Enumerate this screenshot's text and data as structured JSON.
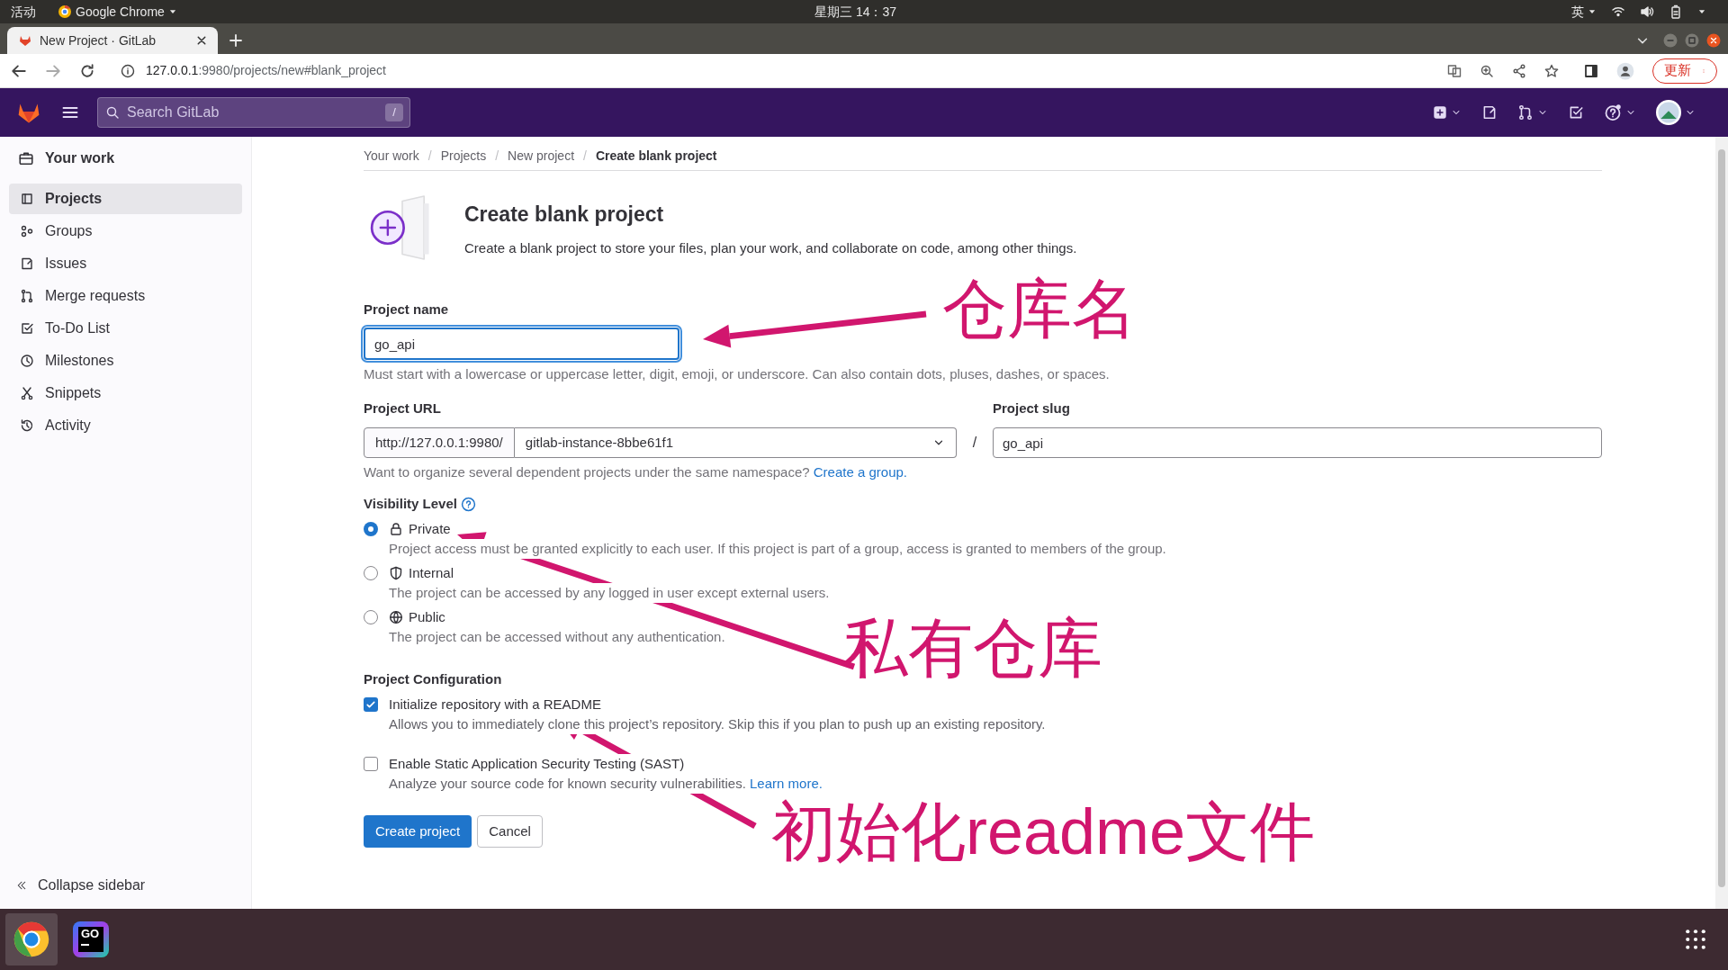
{
  "system_bar": {
    "activities": "活动",
    "app": "Google Chrome",
    "clock": "星期三 14：37",
    "input_method": "英"
  },
  "browser": {
    "tab_title": "New Project · GitLab",
    "url_host": "127.0.0.1",
    "url_rest": ":9980/projects/new#blank_project",
    "update_button": "更新"
  },
  "gitlab_header": {
    "search_placeholder": "Search GitLab",
    "search_shortcut": "/"
  },
  "sidebar": {
    "title": "Your work",
    "items": [
      {
        "label": "Projects",
        "selected": true
      },
      {
        "label": "Groups",
        "selected": false
      },
      {
        "label": "Issues",
        "selected": false
      },
      {
        "label": "Merge requests",
        "selected": false
      },
      {
        "label": "To-Do List",
        "selected": false
      },
      {
        "label": "Milestones",
        "selected": false
      },
      {
        "label": "Snippets",
        "selected": false
      },
      {
        "label": "Activity",
        "selected": false
      }
    ],
    "collapse": "Collapse sidebar"
  },
  "breadcrumbs": [
    {
      "label": "Your work"
    },
    {
      "separator": "/",
      "label": "Projects"
    },
    {
      "separator": "/",
      "label": "New project"
    },
    {
      "separator": "/",
      "label": "Create blank project"
    }
  ],
  "page": {
    "title": "Create blank project",
    "description": "Create a blank project to store your files, plan your work, and collaborate on code, among other things."
  },
  "form": {
    "project_name": {
      "label": "Project name",
      "value": "go_api",
      "help": "Must start with a lowercase or uppercase letter, digit, emoji, or underscore. Can also contain dots, pluses, dashes, or spaces."
    },
    "project_url": {
      "label": "Project URL",
      "prefix": "http://127.0.0.1:9980/",
      "namespace": "gitlab-instance-8bbe61f1",
      "separator": "/",
      "help": "Want to organize several dependent projects under the same namespace?",
      "help_link": "Create a group."
    },
    "project_slug": {
      "label": "Project slug",
      "value": "go_api"
    },
    "visibility": {
      "label": "Visibility Level",
      "options": [
        {
          "label": "Private",
          "selected": true,
          "description": "Project access must be granted explicitly to each user. If this project is part of a group, access is granted to members of the group."
        },
        {
          "label": "Internal",
          "selected": false,
          "description": "The project can be accessed by any logged in user except external users."
        },
        {
          "label": "Public",
          "selected": false,
          "description": "The project can be accessed without any authentication."
        }
      ]
    },
    "configuration": {
      "label": "Project Configuration",
      "options": [
        {
          "label": "Initialize repository with a README",
          "checked": true,
          "description": "Allows you to immediately clone this project’s repository. Skip this if you plan to push up an existing repository."
        },
        {
          "label": "Enable Static Application Security Testing (SAST)",
          "checked": false,
          "description": "Analyze your source code for known security vulnerabilities.",
          "link": "Learn more."
        }
      ]
    },
    "buttons": {
      "primary": "Create project",
      "secondary": "Cancel"
    }
  },
  "annotations": [
    {
      "text": "仓库名"
    },
    {
      "text": "私有仓库"
    },
    {
      "text": "初始化readme文件"
    }
  ],
  "taskbar": {
    "apps": [
      {
        "kind": "chrome",
        "selected": true
      },
      {
        "kind": "goland",
        "label": "GO",
        "selected": false
      }
    ]
  }
}
